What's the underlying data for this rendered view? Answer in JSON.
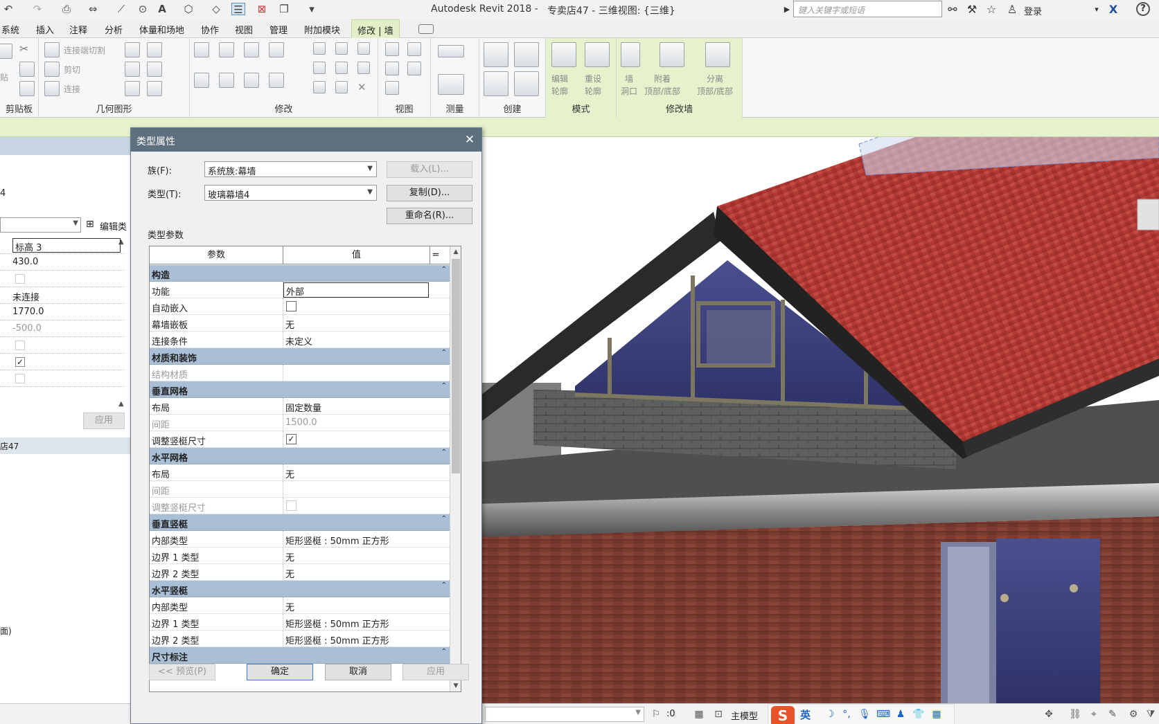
{
  "app": {
    "title": "Autodesk Revit 2018 -",
    "view_title": "专卖店47 - 三维视图: {三维}",
    "search_placeholder": "键入关键字或短语",
    "login": "登录"
  },
  "ribbon_tabs": [
    "系统",
    "插入",
    "注释",
    "分析",
    "体量和场地",
    "协作",
    "视图",
    "管理",
    "附加模块",
    "修改 | 墙"
  ],
  "ribbon": {
    "groups": {
      "clipboard": "剪贴板",
      "geometry": "几何图形",
      "modify": "修改",
      "view": "视图",
      "measure": "测量",
      "create": "创建",
      "mode": "模式",
      "modify_wall": "修改墙"
    },
    "geometry_items": [
      "连接端切割",
      "剪切",
      "连接"
    ],
    "clipboard_item": "贴",
    "mode_items": [
      "编辑\n轮廓",
      "重设\n轮廓"
    ],
    "modify_wall_items": [
      "墙\n洞口",
      "附着\n顶部/底部",
      "分离\n顶部/底部"
    ]
  },
  "left_panel": {
    "type_text": "4",
    "edit_type": "编辑类",
    "rows": [
      {
        "kind": "box",
        "value": "标高 3"
      },
      {
        "kind": "text",
        "value": "430.0"
      },
      {
        "kind": "check",
        "checked": false
      },
      {
        "kind": "text",
        "value": "未连接"
      },
      {
        "kind": "text",
        "value": "1770.0"
      },
      {
        "kind": "grey",
        "value": "-500.0"
      },
      {
        "kind": "check",
        "checked": false
      },
      {
        "kind": "check",
        "checked": true
      },
      {
        "kind": "check",
        "checked": false
      }
    ],
    "apply": "应用",
    "browser_title": "店47",
    "tree_item": "面)"
  },
  "dialog": {
    "title": "类型属性",
    "family_label": "族(F):",
    "family_value": "系统族:幕墙",
    "type_label": "类型(T):",
    "type_value": "玻璃幕墙4",
    "load_button": "载入(L)...",
    "duplicate_button": "复制(D)...",
    "rename_button": "重命名(R)...",
    "section_title": "类型参数",
    "col_param": "参数",
    "col_value": "值",
    "col_eq": "=",
    "rows": [
      {
        "type": "cat",
        "name": "构造"
      },
      {
        "type": "row",
        "param": "功能",
        "value": "外部",
        "edit": true
      },
      {
        "type": "row",
        "param": "自动嵌入",
        "check": false
      },
      {
        "type": "row",
        "param": "幕墙嵌板",
        "value": "无"
      },
      {
        "type": "row",
        "param": "连接条件",
        "value": "未定义"
      },
      {
        "type": "cat",
        "name": "材质和装饰"
      },
      {
        "type": "row",
        "param": "结构材质",
        "value": "",
        "grey": true
      },
      {
        "type": "cat",
        "name": "垂直网格"
      },
      {
        "type": "row",
        "param": "布局",
        "value": "固定数量"
      },
      {
        "type": "row",
        "param": "间距",
        "value": "1500.0",
        "grey": true
      },
      {
        "type": "row",
        "param": "调整竖梃尺寸",
        "check": true
      },
      {
        "type": "cat",
        "name": "水平网格"
      },
      {
        "type": "row",
        "param": "布局",
        "value": "无"
      },
      {
        "type": "row",
        "param": "间距",
        "value": "",
        "grey": true
      },
      {
        "type": "row",
        "param": "调整竖梃尺寸",
        "check": false,
        "grey": true
      },
      {
        "type": "cat",
        "name": "垂直竖梃"
      },
      {
        "type": "row",
        "param": "内部类型",
        "value": "矩形竖梃 : 50mm 正方形"
      },
      {
        "type": "row",
        "param": "边界 1 类型",
        "value": "无"
      },
      {
        "type": "row",
        "param": "边界 2 类型",
        "value": "无"
      },
      {
        "type": "cat",
        "name": "水平竖梃"
      },
      {
        "type": "row",
        "param": "内部类型",
        "value": "无"
      },
      {
        "type": "row",
        "param": "边界 1 类型",
        "value": "矩形竖梃 : 50mm 正方形"
      },
      {
        "type": "row",
        "param": "边界 2 类型",
        "value": "矩形竖梃 : 50mm 正方形"
      },
      {
        "type": "cat",
        "name": "尺寸标注"
      }
    ],
    "preview_button": "<< 预览(P)",
    "ok_button": "确定",
    "cancel_button": "取消",
    "apply_button": "应用"
  },
  "statusbar": {
    "zero": ":0",
    "model_label": "主模型",
    "ime_logo": "S",
    "ime_lang": "英"
  },
  "colors": {
    "context_tab": "#e3f0c7",
    "dialog_title": "#5e6f7e",
    "category_row": "#a8bfd6",
    "roof": "#b23a35",
    "glass": "#3b3f7a",
    "brick": "#7a3a30"
  }
}
